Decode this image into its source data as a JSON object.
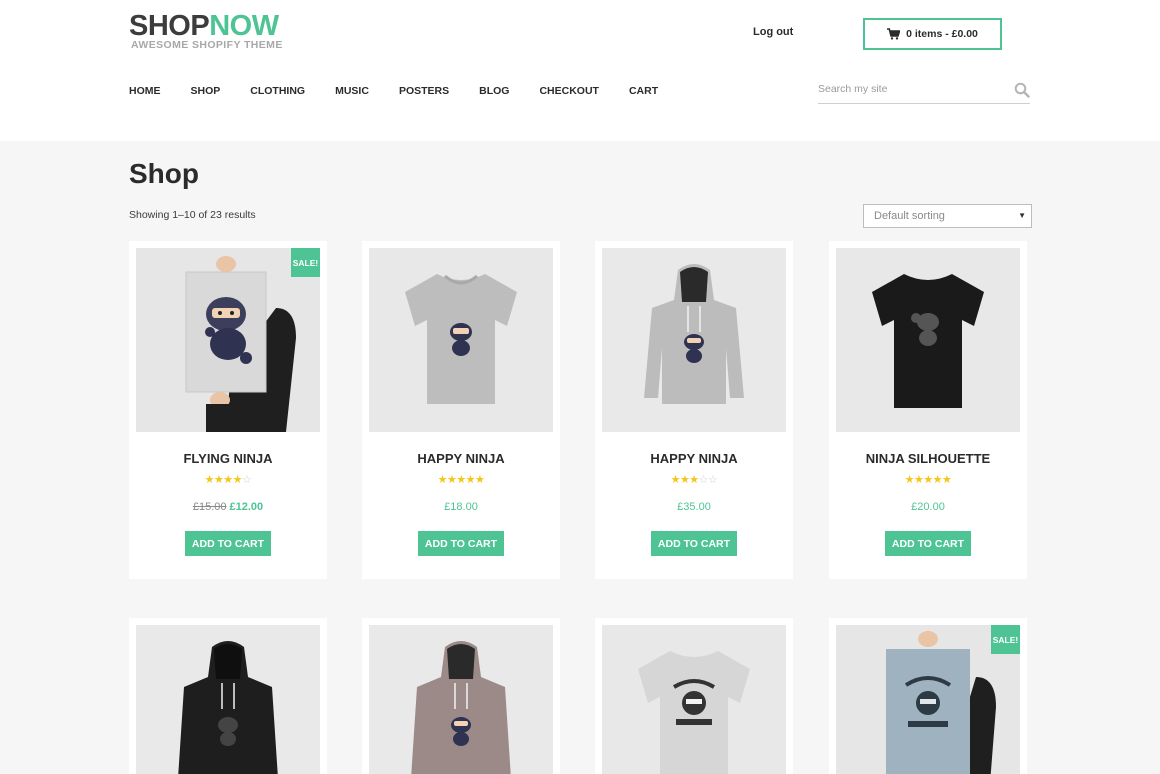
{
  "header": {
    "logo_part1": "SHOP",
    "logo_part2": "NOW",
    "tagline": "AWESOME SHOPIFY THEME",
    "logout": "Log out",
    "cart_summary": "0 items - £0.00",
    "search_placeholder": "Search my site"
  },
  "nav": [
    {
      "label": "HOME"
    },
    {
      "label": "SHOP"
    },
    {
      "label": "CLOTHING"
    },
    {
      "label": "MUSIC"
    },
    {
      "label": "POSTERS"
    },
    {
      "label": "BLOG"
    },
    {
      "label": "CHECKOUT"
    },
    {
      "label": "CART"
    }
  ],
  "main": {
    "title": "Shop",
    "result_count": "Showing 1–10 of 23 results",
    "sort_selected": "Default sorting"
  },
  "products": [
    {
      "name": "FLYING NINJA",
      "rating": 4,
      "old_price": "£15.00",
      "price": "£12.00",
      "sale_badge": "SALE!",
      "image": "poster-ninja",
      "button": "ADD TO CART"
    },
    {
      "name": "HAPPY NINJA",
      "rating": 5,
      "price": "£18.00",
      "image": "tshirt-grey-ninja",
      "button": "ADD TO CART"
    },
    {
      "name": "HAPPY NINJA",
      "rating": 3,
      "price": "£35.00",
      "image": "hoodie-grey-ninja",
      "button": "ADD TO CART"
    },
    {
      "name": "NINJA SILHOUETTE",
      "rating": 5,
      "price": "£20.00",
      "image": "tshirt-black-ninja",
      "button": "ADD TO CART"
    },
    {
      "image": "hoodie-black-ninja"
    },
    {
      "image": "hoodie-mauve-ninja"
    },
    {
      "image": "tshirt-white-woothemes"
    },
    {
      "sale_badge": "SALE!",
      "image": "poster-blue-woothemes"
    }
  ],
  "colors": {
    "accent": "#4ec494",
    "star": "#f5c518",
    "text": "#2b2b2b",
    "background": "#f6f6f6"
  }
}
